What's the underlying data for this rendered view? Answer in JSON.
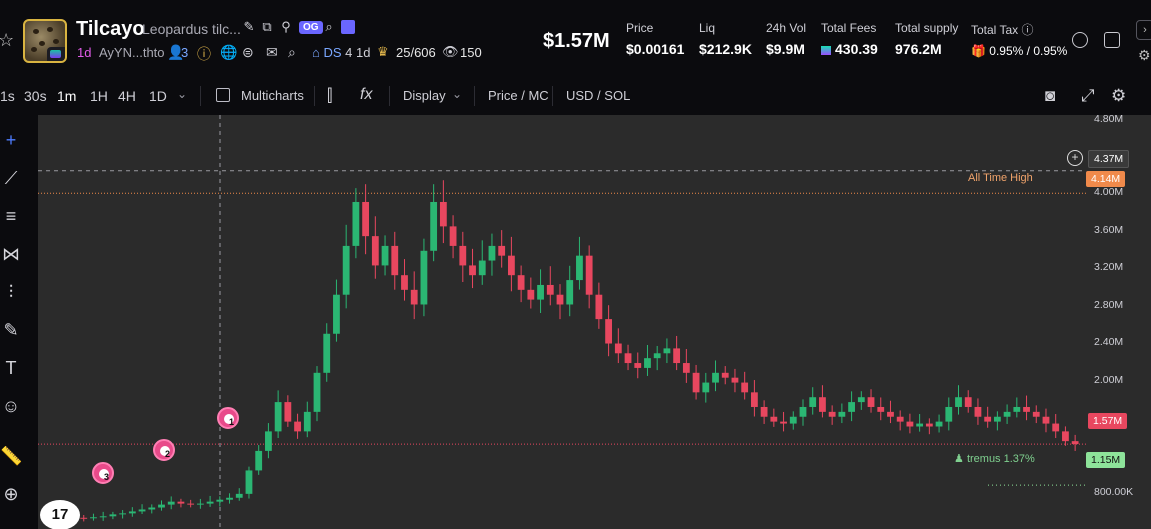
{
  "token": {
    "symbol": "Tilcayo",
    "full_name": "Leopardus tilc...",
    "og_badge": "OG",
    "age": "1d",
    "address": "AyYN...thto",
    "holders": "3",
    "dev_sells": "DS",
    "dev_sells_age": "4 1d",
    "pro_traders": "25/606",
    "watchers": "150"
  },
  "stats": {
    "market_cap": "$1.57M",
    "price_label": "Price",
    "price": "$0.00161",
    "liq_label": "Liq",
    "liq": "$212.9K",
    "vol_label": "24h Vol",
    "vol": "$9.9M",
    "fees_label": "Total Fees",
    "fees": "430.39",
    "supply_label": "Total supply",
    "supply": "976.2M",
    "tax_label": "Total Tax",
    "tax": "0.95% / 0.95%"
  },
  "toolbar": {
    "timeframes": [
      "1s",
      "30s",
      "1m",
      "1H",
      "4H",
      "1D"
    ],
    "active_timeframe": "1m",
    "multicharts": "Multicharts",
    "display": "Display",
    "price_mc": "Price / MC",
    "usd_sol": "USD / SOL"
  },
  "chart": {
    "y_axis": [
      "4.80M",
      "4.00M",
      "3.60M",
      "3.20M",
      "2.80M",
      "2.40M",
      "2.00M",
      "800.00K"
    ],
    "crosshair_value": "4.37M",
    "ath_label": "All Time High",
    "ath_value": "4.14M",
    "current_value": "1.57M",
    "tremus_label": "tremus 1.37%",
    "tremus_value": "1.15M",
    "markers": [
      "3",
      "2",
      "1"
    ],
    "colors": {
      "up": "#2bb673",
      "down": "#e8475f",
      "ath": "#f08a4b",
      "bg": "#2b2b2b"
    }
  },
  "chart_data": {
    "type": "candlestick",
    "ylim": [
      700000,
      4900000
    ],
    "close_series_mc": [
      840000,
      830000,
      820000,
      815000,
      810000,
      820000,
      830000,
      850000,
      860000,
      880000,
      900000,
      920000,
      950000,
      980000,
      960000,
      950000,
      960000,
      980000,
      1000000,
      1020000,
      1060000,
      1300000,
      1500000,
      1700000,
      2000000,
      1800000,
      1700000,
      1900000,
      2300000,
      2700000,
      3100000,
      3600000,
      4050000,
      3700000,
      3400000,
      3600000,
      3300000,
      3150000,
      3000000,
      3550000,
      4050000,
      3800000,
      3600000,
      3400000,
      3300000,
      3450000,
      3600000,
      3500000,
      3300000,
      3150000,
      3050000,
      3200000,
      3100000,
      3000000,
      3250000,
      3500000,
      3100000,
      2850000,
      2600000,
      2500000,
      2400000,
      2350000,
      2450000,
      2500000,
      2550000,
      2400000,
      2300000,
      2100000,
      2200000,
      2300000,
      2250000,
      2200000,
      2100000,
      1950000,
      1850000,
      1800000,
      1780000,
      1850000,
      1950000,
      2050000,
      1900000,
      1850000,
      1900000,
      2000000,
      2050000,
      1950000,
      1900000,
      1850000,
      1800000,
      1750000,
      1780000,
      1750000,
      1800000,
      1950000,
      2050000,
      1950000,
      1850000,
      1800000,
      1850000,
      1900000,
      1950000,
      1900000,
      1850000,
      1780000,
      1700000,
      1600000,
      1570000
    ]
  }
}
